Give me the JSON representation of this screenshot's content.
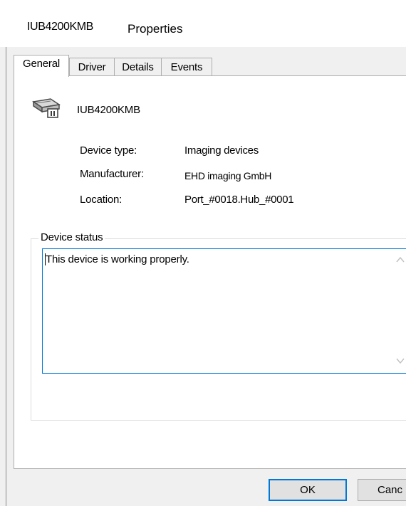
{
  "window": {
    "device_name": "IUB4200KMB",
    "title": "Properties"
  },
  "tabs": [
    {
      "label": "General",
      "active": true
    },
    {
      "label": "Driver",
      "active": false
    },
    {
      "label": "Details",
      "active": false
    },
    {
      "label": "Events",
      "active": false
    }
  ],
  "device": {
    "icon": "imaging-device-icon",
    "name": "IUB4200KMB"
  },
  "properties": [
    {
      "label": "Device type:",
      "value": "Imaging devices"
    },
    {
      "label": "Manufacturer:",
      "value": "EHD imaging GmbH"
    },
    {
      "label": "Location:",
      "value": "Port_#0018.Hub_#0001"
    }
  ],
  "status": {
    "group_label": "Device status",
    "text": "This device is working properly."
  },
  "buttons": {
    "ok_label": "OK",
    "cancel_label": "Canc"
  },
  "colors": {
    "accent": "#0078d7",
    "dialog_bg": "#f0f0f0",
    "button_bg": "#e1e1e1"
  }
}
